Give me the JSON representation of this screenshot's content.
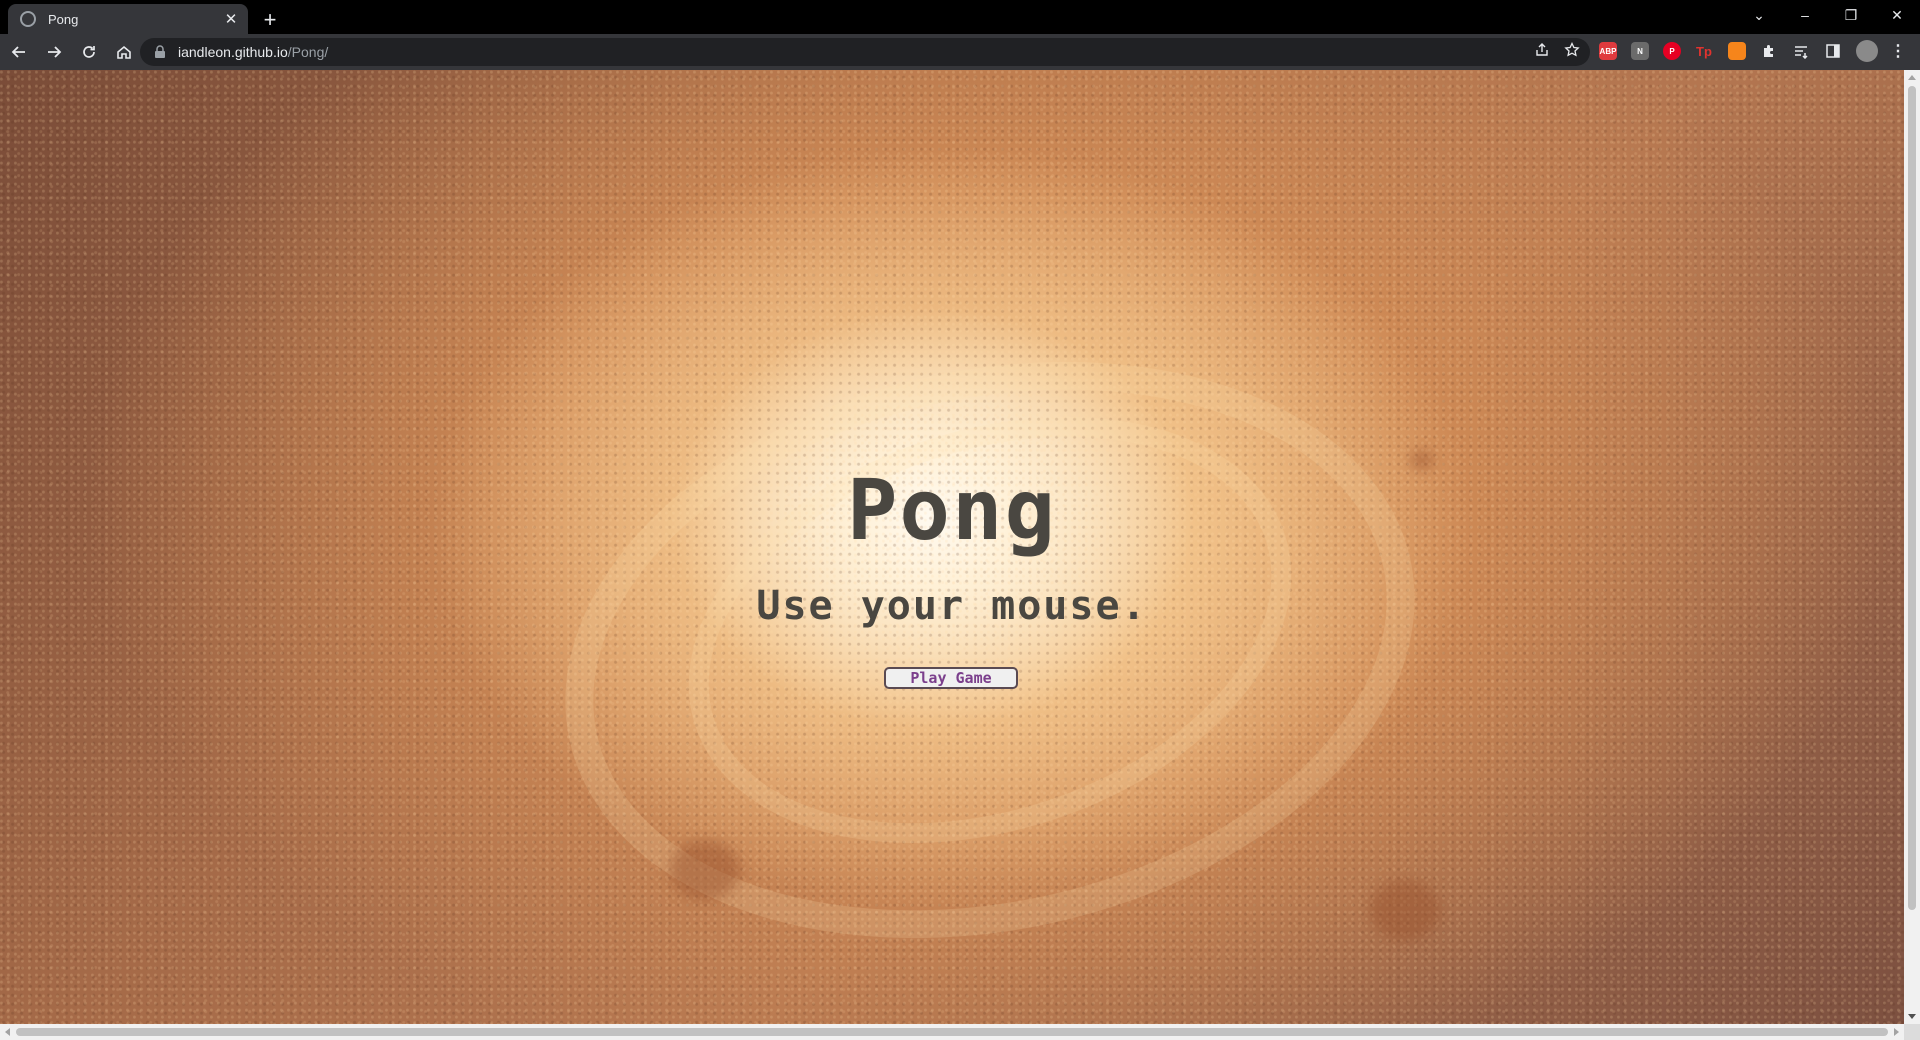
{
  "browser": {
    "tab_title": "Pong",
    "new_tab_label": "+",
    "url_host": "iandleon.github.io",
    "url_path": "/Pong/",
    "window_controls": [
      "⌄",
      "–",
      "❐",
      "✕"
    ],
    "extensions": [
      {
        "name": "adblock-plus-icon",
        "label": "ABP",
        "color": "#e03a3e"
      },
      {
        "name": "notion-icon",
        "label": "N",
        "color": "#6b6b6b"
      },
      {
        "name": "pinterest-icon",
        "label": "P",
        "color": "#e60023"
      },
      {
        "name": "tp-icon",
        "label": "Tp",
        "color": "#d9262c"
      },
      {
        "name": "metamask-icon",
        "label": "",
        "color": "#f6851b"
      }
    ]
  },
  "page": {
    "title": "Pong",
    "subtitle": "Use your mouse.",
    "play_button": "Play Game"
  },
  "colors": {
    "title_text": "#4a4741",
    "button_text": "#7b3f8c",
    "chrome_dark": "#35363a",
    "tab_strip": "#000000"
  }
}
